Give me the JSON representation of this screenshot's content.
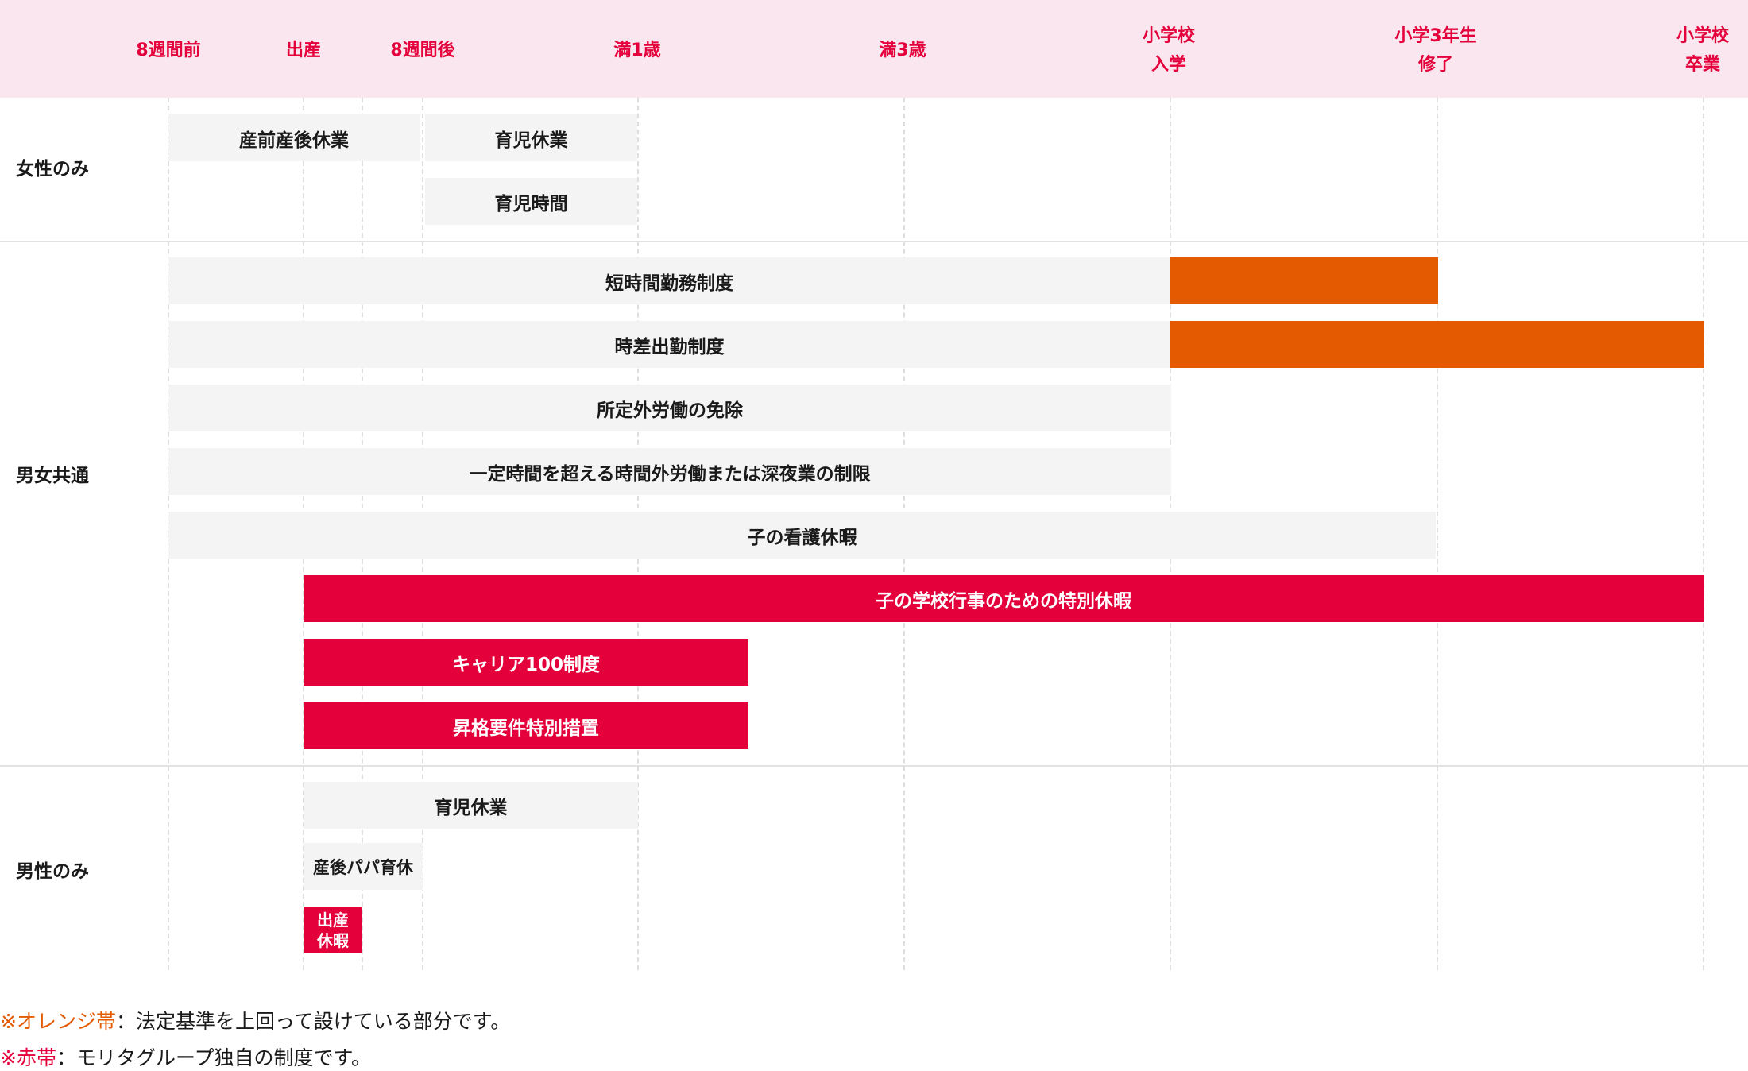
{
  "timeline": {
    "ticks": [
      {
        "line1": "8週間前",
        "line2": ""
      },
      {
        "line1": "出産",
        "line2": ""
      },
      {
        "line1": "8週間後",
        "line2": ""
      },
      {
        "line1": "満1歳",
        "line2": ""
      },
      {
        "line1": "満3歳",
        "line2": ""
      },
      {
        "line1": "小学校",
        "line2": "入学"
      },
      {
        "line1": "小学3年生",
        "line2": "修了"
      },
      {
        "line1": "小学校",
        "line2": "卒業"
      }
    ]
  },
  "sections": {
    "women": {
      "label": "女性のみ",
      "bars": [
        "産前産後休業",
        "育児休業",
        "育児時間"
      ]
    },
    "common": {
      "label": "男女共通",
      "bars": [
        "短時間勤務制度",
        "時差出勤制度",
        "所定外労働の免除",
        "一定時間を超える時間外労働または深夜業の制限",
        "子の看護休暇",
        "子の学校行事のための特別休暇",
        "キャリア100制度",
        "昇格要件特別措置"
      ]
    },
    "men": {
      "label": "男性のみ",
      "bars": [
        "育児休業",
        "産後パパ育休",
        "出産",
        "休暇"
      ]
    }
  },
  "legend": {
    "orange_key": "※オレンジ帯",
    "orange_text": "：法定基準を上回って設けている部分です。",
    "red_key": "※赤帯",
    "red_text": "：モリタグループ独自の制度です。"
  },
  "colors": {
    "red": "#e4003b",
    "orange": "#e45a00",
    "gray_bar": "#f4f4f4",
    "header_band": "#fae6ee"
  }
}
